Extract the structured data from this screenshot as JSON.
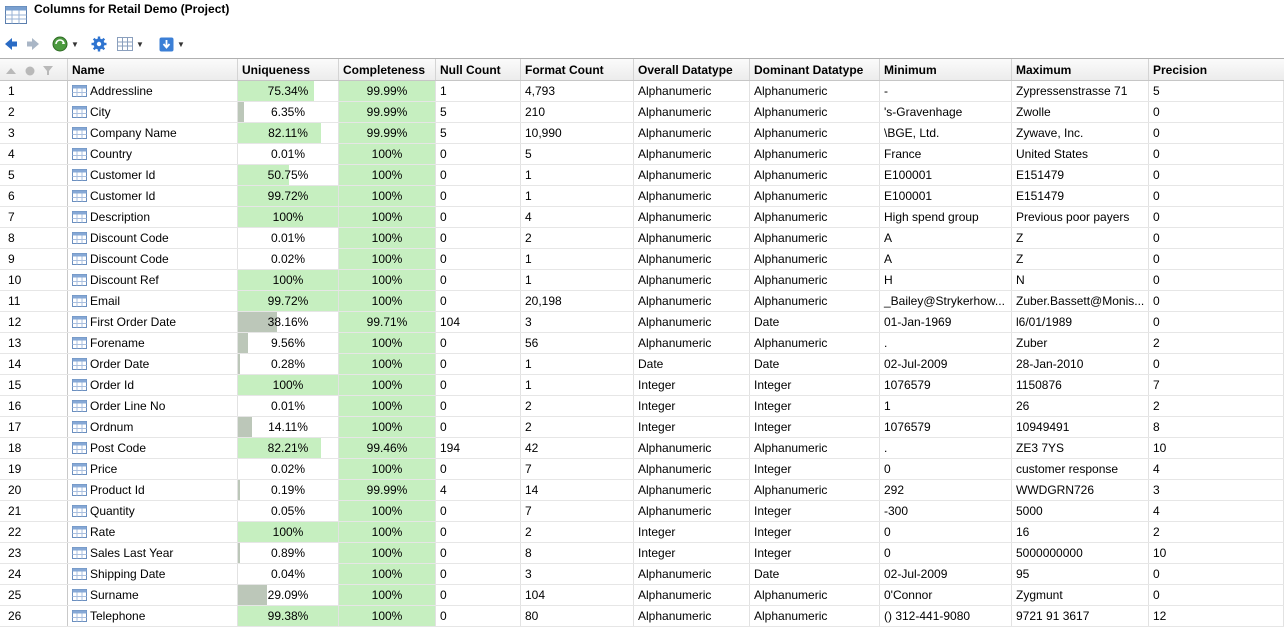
{
  "window": {
    "title": "Columns for Retail Demo (Project)"
  },
  "toolbar": {
    "icons": [
      "back-arrow-icon",
      "forward-arrow-icon",
      "refresh-globe-icon",
      "gear-icon",
      "table-view-icon",
      "download-icon"
    ]
  },
  "colors": {
    "bar_high": "#c6efc0",
    "bar_low": "#c8d6c2",
    "bar_gray": "#bcc7b9"
  },
  "columns": [
    "Name",
    "Uniqueness",
    "Completeness",
    "Null Count",
    "Format Count",
    "Overall Datatype",
    "Dominant Datatype",
    "Minimum",
    "Maximum",
    "Precision"
  ],
  "rows": [
    {
      "n": "1",
      "name": "Addressline",
      "uniq": "75.34%",
      "u": 0.7534,
      "comp": "99.99%",
      "c": 0.9999,
      "nullc": "1",
      "fmt": "4,793",
      "overall": "Alphanumeric",
      "dominant": "Alphanumeric",
      "min": "-",
      "max": "Zypressenstrasse 71",
      "prec": "5"
    },
    {
      "n": "2",
      "name": "City",
      "uniq": "6.35%",
      "u": 0.0635,
      "comp": "99.99%",
      "c": 0.9999,
      "nullc": "5",
      "fmt": "210",
      "overall": "Alphanumeric",
      "dominant": "Alphanumeric",
      "min": "'s-Gravenhage",
      "max": "Zwolle",
      "prec": "0"
    },
    {
      "n": "3",
      "name": "Company Name",
      "uniq": "82.11%",
      "u": 0.8211,
      "comp": "99.99%",
      "c": 0.9999,
      "nullc": "5",
      "fmt": "10,990",
      "overall": "Alphanumeric",
      "dominant": "Alphanumeric",
      "min": "\\BGE, Ltd.",
      "max": "Zywave, Inc.",
      "prec": "0"
    },
    {
      "n": "4",
      "name": "Country",
      "uniq": "0.01%",
      "u": 0.0001,
      "comp": "100%",
      "c": 1,
      "nullc": "0",
      "fmt": "5",
      "overall": "Alphanumeric",
      "dominant": "Alphanumeric",
      "min": "France",
      "max": "United States",
      "prec": "0"
    },
    {
      "n": "5",
      "name": "Customer Id",
      "uniq": "50.75%",
      "u": 0.5075,
      "comp": "100%",
      "c": 1,
      "nullc": "0",
      "fmt": "1",
      "overall": "Alphanumeric",
      "dominant": "Alphanumeric",
      "min": "E100001",
      "max": "E151479",
      "prec": "0"
    },
    {
      "n": "6",
      "name": "Customer Id",
      "uniq": "99.72%",
      "u": 0.9972,
      "comp": "100%",
      "c": 1,
      "nullc": "0",
      "fmt": "1",
      "overall": "Alphanumeric",
      "dominant": "Alphanumeric",
      "min": "E100001",
      "max": "E151479",
      "prec": "0"
    },
    {
      "n": "7",
      "name": "Description",
      "uniq": "100%",
      "u": 1,
      "comp": "100%",
      "c": 1,
      "nullc": "0",
      "fmt": "4",
      "overall": "Alphanumeric",
      "dominant": "Alphanumeric",
      "min": "High spend group",
      "max": "Previous poor payers",
      "prec": "0"
    },
    {
      "n": "8",
      "name": "Discount Code",
      "uniq": "0.01%",
      "u": 0.0001,
      "comp": "100%",
      "c": 1,
      "nullc": "0",
      "fmt": "2",
      "overall": "Alphanumeric",
      "dominant": "Alphanumeric",
      "min": "A",
      "max": "Z",
      "prec": "0"
    },
    {
      "n": "9",
      "name": "Discount Code",
      "uniq": "0.02%",
      "u": 0.0002,
      "comp": "100%",
      "c": 1,
      "nullc": "0",
      "fmt": "1",
      "overall": "Alphanumeric",
      "dominant": "Alphanumeric",
      "min": "A",
      "max": "Z",
      "prec": "0"
    },
    {
      "n": "10",
      "name": "Discount Ref",
      "uniq": "100%",
      "u": 1,
      "comp": "100%",
      "c": 1,
      "nullc": "0",
      "fmt": "1",
      "overall": "Alphanumeric",
      "dominant": "Alphanumeric",
      "min": "H",
      "max": "N",
      "prec": "0"
    },
    {
      "n": "11",
      "name": "Email",
      "uniq": "99.72%",
      "u": 0.9972,
      "comp": "100%",
      "c": 1,
      "nullc": "0",
      "fmt": "20,198",
      "overall": "Alphanumeric",
      "dominant": "Alphanumeric",
      "min": "_Bailey@Strykerhow...",
      "max": "Zuber.Bassett@Monis...",
      "prec": "0"
    },
    {
      "n": "12",
      "name": "First Order Date",
      "uniq": "38.16%",
      "u": 0.3816,
      "comp": "99.71%",
      "c": 0.9971,
      "nullc": "104",
      "fmt": "3",
      "overall": "Alphanumeric",
      "dominant": "Date",
      "min": "01-Jan-1969",
      "max": "l6/01/1989",
      "prec": "0"
    },
    {
      "n": "13",
      "name": "Forename",
      "uniq": "9.56%",
      "u": 0.0956,
      "comp": "100%",
      "c": 1,
      "nullc": "0",
      "fmt": "56",
      "overall": "Alphanumeric",
      "dominant": "Alphanumeric",
      "min": ".",
      "max": "Zuber",
      "prec": "2"
    },
    {
      "n": "14",
      "name": "Order Date",
      "uniq": "0.28%",
      "u": 0.0028,
      "comp": "100%",
      "c": 1,
      "nullc": "0",
      "fmt": "1",
      "overall": "Date",
      "dominant": "Date",
      "min": "02-Jul-2009",
      "max": "28-Jan-2010",
      "prec": "0"
    },
    {
      "n": "15",
      "name": "Order Id",
      "uniq": "100%",
      "u": 1,
      "comp": "100%",
      "c": 1,
      "nullc": "0",
      "fmt": "1",
      "overall": "Integer",
      "dominant": "Integer",
      "min": "1076579",
      "max": "1150876",
      "prec": "7"
    },
    {
      "n": "16",
      "name": "Order Line No",
      "uniq": "0.01%",
      "u": 0.0001,
      "comp": "100%",
      "c": 1,
      "nullc": "0",
      "fmt": "2",
      "overall": "Integer",
      "dominant": "Integer",
      "min": "1",
      "max": "26",
      "prec": "2"
    },
    {
      "n": "17",
      "name": "Ordnum",
      "uniq": "14.11%",
      "u": 0.1411,
      "comp": "100%",
      "c": 1,
      "nullc": "0",
      "fmt": "2",
      "overall": "Integer",
      "dominant": "Integer",
      "min": "1076579",
      "max": "10949491",
      "prec": "8"
    },
    {
      "n": "18",
      "name": "Post Code",
      "uniq": "82.21%",
      "u": 0.8221,
      "comp": "99.46%",
      "c": 0.9946,
      "nullc": "194",
      "fmt": "42",
      "overall": "Alphanumeric",
      "dominant": "Alphanumeric",
      "min": ".",
      "max": "ZE3 7YS",
      "prec": "10"
    },
    {
      "n": "19",
      "name": "Price",
      "uniq": "0.02%",
      "u": 0.0002,
      "comp": "100%",
      "c": 1,
      "nullc": "0",
      "fmt": "7",
      "overall": "Alphanumeric",
      "dominant": "Integer",
      "min": "0",
      "max": "customer response",
      "prec": "4"
    },
    {
      "n": "20",
      "name": "Product Id",
      "uniq": "0.19%",
      "u": 0.0019,
      "comp": "99.99%",
      "c": 0.9999,
      "nullc": "4",
      "fmt": "14",
      "overall": "Alphanumeric",
      "dominant": "Alphanumeric",
      "min": "292",
      "max": "WWDGRN726",
      "prec": "3"
    },
    {
      "n": "21",
      "name": "Quantity",
      "uniq": "0.05%",
      "u": 0.0005,
      "comp": "100%",
      "c": 1,
      "nullc": "0",
      "fmt": "7",
      "overall": "Alphanumeric",
      "dominant": "Integer",
      "min": "-300",
      "max": "5000",
      "prec": "4"
    },
    {
      "n": "22",
      "name": "Rate",
      "uniq": "100%",
      "u": 1,
      "comp": "100%",
      "c": 1,
      "nullc": "0",
      "fmt": "2",
      "overall": "Integer",
      "dominant": "Integer",
      "min": "0",
      "max": "16",
      "prec": "2"
    },
    {
      "n": "23",
      "name": "Sales Last Year",
      "uniq": "0.89%",
      "u": 0.0089,
      "comp": "100%",
      "c": 1,
      "nullc": "0",
      "fmt": "8",
      "overall": "Integer",
      "dominant": "Integer",
      "min": "0",
      "max": "5000000000",
      "prec": "10"
    },
    {
      "n": "24",
      "name": "Shipping Date",
      "uniq": "0.04%",
      "u": 0.0004,
      "comp": "100%",
      "c": 1,
      "nullc": "0",
      "fmt": "3",
      "overall": "Alphanumeric",
      "dominant": "Date",
      "min": "02-Jul-2009",
      "max": "95",
      "prec": "0"
    },
    {
      "n": "25",
      "name": "Surname",
      "uniq": "29.09%",
      "u": 0.2909,
      "comp": "100%",
      "c": 1,
      "nullc": "0",
      "fmt": "104",
      "overall": "Alphanumeric",
      "dominant": "Alphanumeric",
      "min": "0'Connor",
      "max": "Zygmunt",
      "prec": "0"
    },
    {
      "n": "26",
      "name": "Telephone",
      "uniq": "99.38%",
      "u": 0.9938,
      "comp": "100%",
      "c": 1,
      "nullc": "0",
      "fmt": "80",
      "overall": "Alphanumeric",
      "dominant": "Alphanumeric",
      "min": "() 312-441-9080",
      "max": "9721 91 3617",
      "prec": "12"
    }
  ]
}
